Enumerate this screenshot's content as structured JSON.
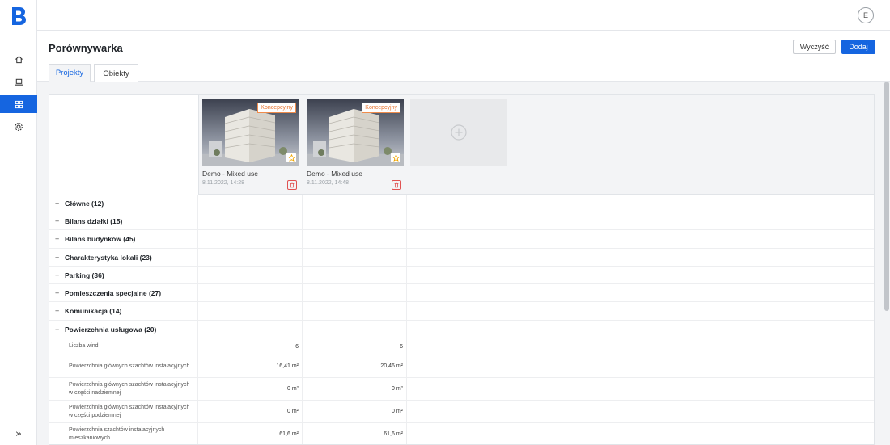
{
  "app": {
    "logo": "B",
    "avatar_initial": "E"
  },
  "sidebar": {
    "items": [
      {
        "icon": "home-icon",
        "active": false
      },
      {
        "icon": "laptop-icon",
        "active": false
      },
      {
        "icon": "grid-icon",
        "active": true
      },
      {
        "icon": "gear-icon",
        "active": false
      }
    ],
    "collapse_label": "»"
  },
  "header": {
    "title": "Porównywarka",
    "clear_label": "Wyczyść",
    "add_label": "Dodaj"
  },
  "tabs": [
    {
      "label": "Projekty",
      "active": true
    },
    {
      "label": "Obiekty",
      "active": false
    }
  ],
  "projects": [
    {
      "name": "Demo - Mixed use",
      "date": "8.11.2022, 14:28",
      "badge": "Koncepcyjny"
    },
    {
      "name": "Demo - Mixed use",
      "date": "8.11.2022, 14:48",
      "badge": "Koncepcyjny"
    }
  ],
  "groups": [
    {
      "label": "Główne (12)",
      "expanded": false,
      "sign": "+"
    },
    {
      "label": "Bilans działki (15)",
      "expanded": false,
      "sign": "+"
    },
    {
      "label": "Bilans budynków (45)",
      "expanded": false,
      "sign": "+"
    },
    {
      "label": "Charakterystyka lokali (23)",
      "expanded": false,
      "sign": "+"
    },
    {
      "label": "Parking (36)",
      "expanded": false,
      "sign": "+"
    },
    {
      "label": "Pomieszczenia specjalne (27)",
      "expanded": false,
      "sign": "+"
    },
    {
      "label": "Komunikacja (14)",
      "expanded": false,
      "sign": "+"
    },
    {
      "label": "Powierzchnia usługowa (20)",
      "expanded": true,
      "sign": "−"
    }
  ],
  "subrows": [
    {
      "label": "Liczba wind",
      "v1": "6",
      "v2": "6"
    },
    {
      "label": "Powierzchnia głównych szachtów instalacyjnych",
      "v1": "16,41 m²",
      "v2": "20,46 m²"
    },
    {
      "label": "Powierzchnia głównych szachtów instalacyjnych w części nadziemnej",
      "v1": "0 m²",
      "v2": "0 m²"
    },
    {
      "label": "Powierzchnia głównych szachtów instalacyjnych w części podziemnej",
      "v1": "0 m²",
      "v2": "0 m²"
    },
    {
      "label": "Powierzchnia szachtów instalacyjnych mieszkaniowych",
      "v1": "61,6 m²",
      "v2": "61,6 m²"
    }
  ],
  "colors": {
    "accent": "#1565e0",
    "badge": "#e8722d",
    "star": "#f0a500",
    "trash": "#e05252"
  }
}
